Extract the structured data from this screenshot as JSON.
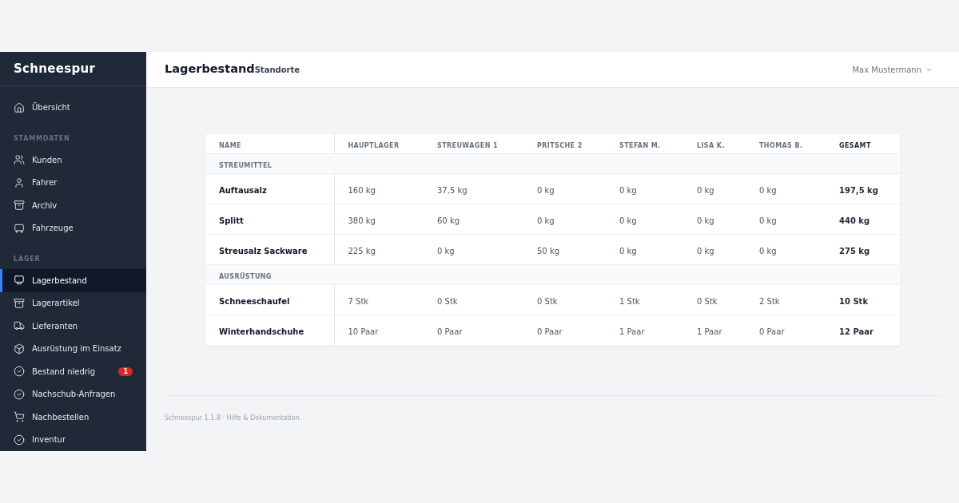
{
  "sidebar": {
    "brand": "Schneespur",
    "sections": [
      {
        "items": [
          {
            "label": "Übersicht",
            "selected": false
          }
        ]
      },
      {
        "title": "STAMMDATEN",
        "items": [
          {
            "label": "Kunden",
            "selected": false
          },
          {
            "label": "Fahrer",
            "selected": false
          },
          {
            "label": "Archiv",
            "selected": false
          },
          {
            "label": "Fahrzeuge",
            "selected": false
          }
        ]
      },
      {
        "title": "LAGER",
        "items": [
          {
            "label": "Lagerbestand",
            "selected": true
          },
          {
            "label": "Lagerartikel",
            "selected": false
          },
          {
            "label": "Lieferanten",
            "selected": false
          },
          {
            "label": "Ausrüstung im Einsatz",
            "selected": false
          },
          {
            "label": "Bestand niedrig",
            "selected": false,
            "badge": "1"
          },
          {
            "label": "Nachschub-Anfragen",
            "selected": false
          },
          {
            "label": "Nachbestellen",
            "selected": false
          },
          {
            "label": "Inventur",
            "selected": false
          }
        ]
      }
    ]
  },
  "header": {
    "title": "Lagerbestand",
    "subtitle": "Standorte",
    "user": "Max Mustermann"
  },
  "table": {
    "columns": [
      "NAME",
      "HAUPTLAGER",
      "STREUWAGEN 1",
      "PRITSCHE 2",
      "STEFAN M.",
      "LISA K.",
      "THOMAS B.",
      "GESAMT"
    ],
    "rows": [
      {
        "kind": "group",
        "label": "STREUMITTEL"
      },
      {
        "kind": "item",
        "name": "Auftausalz",
        "cells": [
          "160 kg",
          "37,5 kg",
          "0 kg",
          "0 kg",
          "0 kg",
          "0 kg"
        ],
        "total": "197,5 kg"
      },
      {
        "kind": "item",
        "name": "Splitt",
        "cells": [
          "380 kg",
          "60 kg",
          "0 kg",
          "0 kg",
          "0 kg",
          "0 kg"
        ],
        "total": "440 kg"
      },
      {
        "kind": "item",
        "name": "Streusalz Sackware",
        "cells": [
          "225 kg",
          "0 kg",
          "50 kg",
          "0 kg",
          "0 kg",
          "0 kg"
        ],
        "total": "275 kg"
      },
      {
        "kind": "group",
        "label": "AUSRÜSTUNG"
      },
      {
        "kind": "item",
        "name": "Schneeschaufel",
        "cells": [
          "7 Stk",
          "0 Stk",
          "0 Stk",
          "1 Stk",
          "0 Stk",
          "2 Stk"
        ],
        "total": "10 Stk"
      },
      {
        "kind": "item",
        "name": "Winterhandschuhe",
        "cells": [
          "10 Paar",
          "0 Paar",
          "0 Paar",
          "1 Paar",
          "1 Paar",
          "0 Paar"
        ],
        "total": "12 Paar"
      }
    ]
  },
  "footer": "Schneespur 1.1.8 · Hilfe & Dokumentation"
}
